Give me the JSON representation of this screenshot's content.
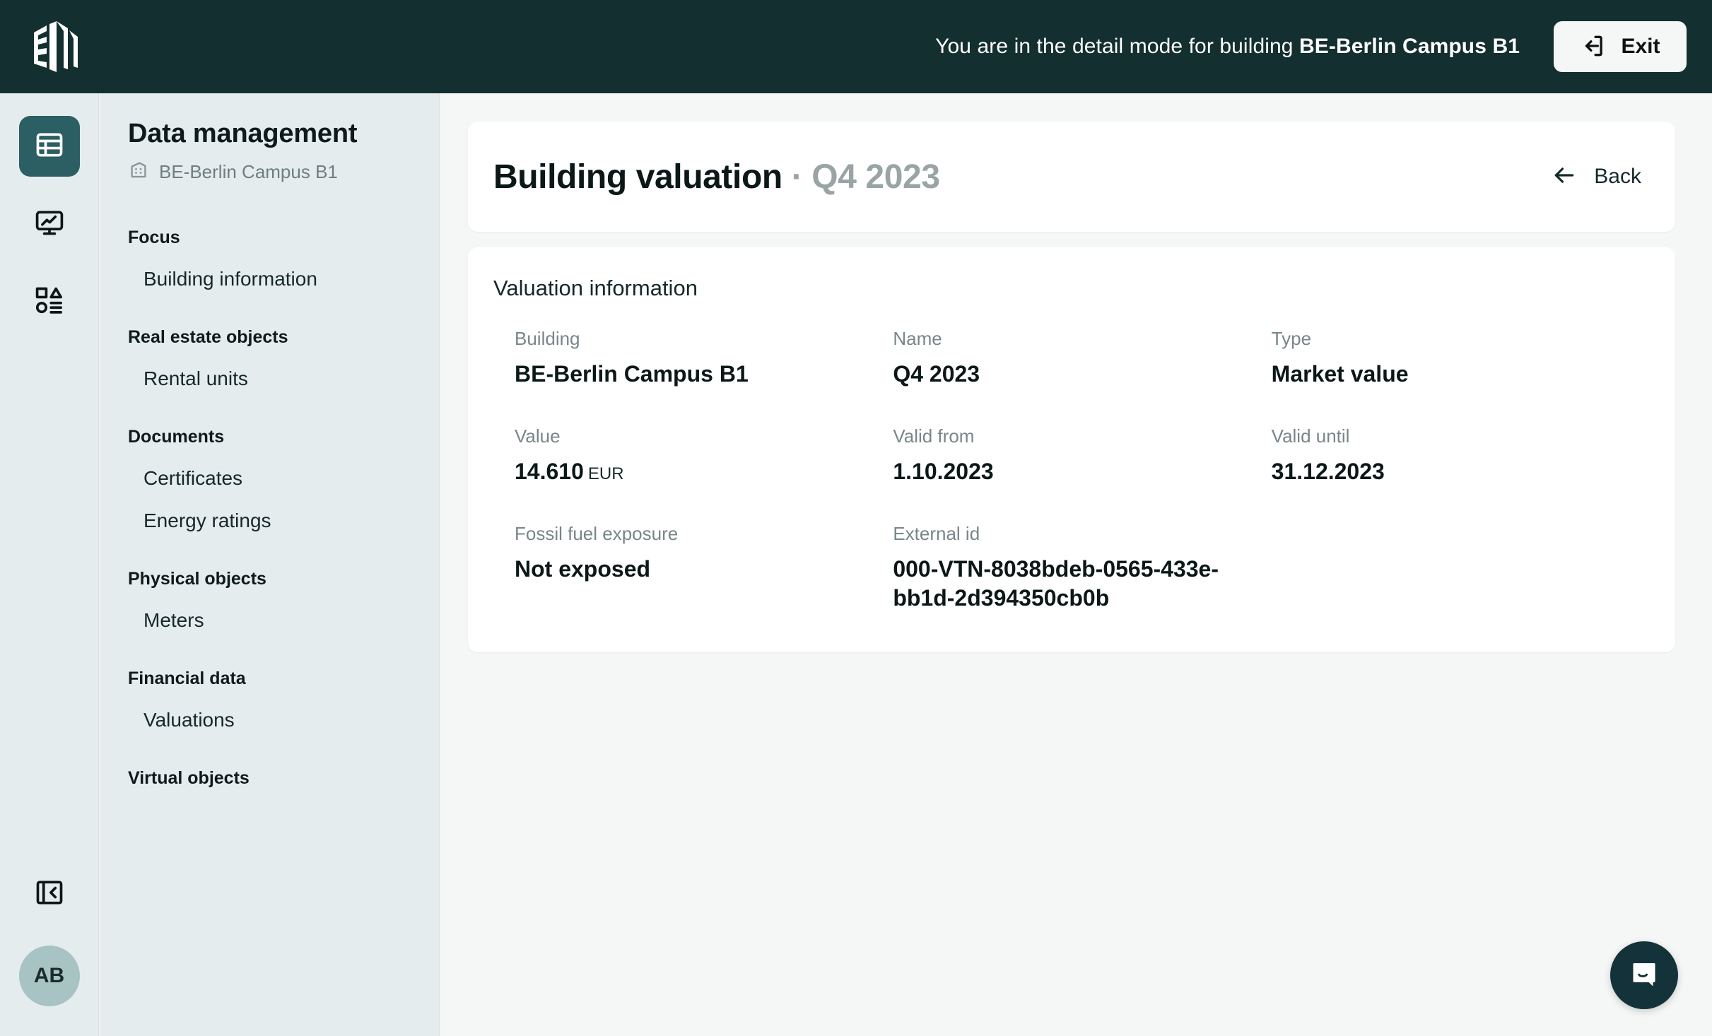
{
  "header": {
    "logo_icon": "building-logo-icon",
    "message_prefix": "You are in the detail mode for building",
    "building_name": "BE-Berlin Campus B1",
    "exit_label": "Exit",
    "exit_icon": "logout-icon",
    "background_color": "#142F30"
  },
  "rail": {
    "items": [
      {
        "icon": "table-icon",
        "name": "data-management",
        "active": true
      },
      {
        "icon": "monitor-chart-icon",
        "name": "analytics",
        "active": false
      },
      {
        "icon": "shapes-list-icon",
        "name": "objects",
        "active": false
      }
    ],
    "collapse_icon": "collapse-sidebar-icon",
    "avatar_initials": "AB",
    "avatar_color": "#A8C3C4",
    "active_color": "#2C5F63",
    "background_color": "#E5ECEE"
  },
  "sidebar": {
    "title": "Data management",
    "breadcrumb_icon": "building-icon",
    "breadcrumb": "BE-Berlin Campus B1",
    "groups": [
      {
        "label": "Focus",
        "items": [
          {
            "label": "Building information"
          }
        ]
      },
      {
        "label": "Real estate objects",
        "items": [
          {
            "label": "Rental units"
          }
        ]
      },
      {
        "label": "Documents",
        "items": [
          {
            "label": "Certificates"
          },
          {
            "label": "Energy ratings"
          }
        ]
      },
      {
        "label": "Physical objects",
        "items": [
          {
            "label": "Meters"
          }
        ]
      },
      {
        "label": "Financial data",
        "items": [
          {
            "label": "Valuations"
          }
        ]
      },
      {
        "label": "Virtual objects",
        "items": []
      }
    ]
  },
  "main": {
    "title": "Building valuation",
    "title_separator": "·",
    "title_suffix": "Q4 2023",
    "back_label": "Back",
    "back_icon": "arrow-left-icon",
    "section_title": "Valuation information",
    "fields": [
      {
        "label": "Building",
        "value": "BE-Berlin Campus B1",
        "unit": ""
      },
      {
        "label": "Name",
        "value": "Q4 2023",
        "unit": ""
      },
      {
        "label": "Type",
        "value": "Market value",
        "unit": ""
      },
      {
        "label": "Value",
        "value": "14.610",
        "unit": "EUR"
      },
      {
        "label": "Valid from",
        "value": "1.10.2023",
        "unit": ""
      },
      {
        "label": "Valid until",
        "value": "31.12.2023",
        "unit": ""
      },
      {
        "label": "Fossil fuel exposure",
        "value": "Not exposed",
        "unit": ""
      },
      {
        "label": "External id",
        "value": "000-VTN-8038bdeb-0565-433e-bb1d-2d394350cb0b",
        "unit": ""
      }
    ]
  },
  "chat": {
    "icon": "chat-bubble-icon",
    "color": "#14323A"
  }
}
